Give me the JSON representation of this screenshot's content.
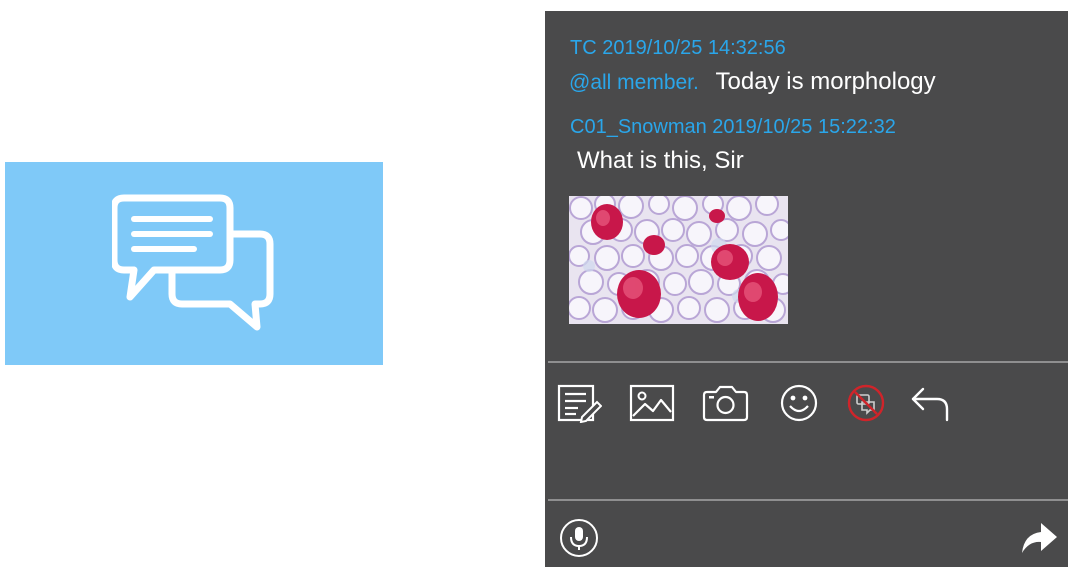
{
  "chat": {
    "messages": [
      {
        "header": "TC 2019/10/25 14:32:56",
        "mention": "@all member.",
        "text": "Today is morphology"
      },
      {
        "header": "C01_Snowman 2019/10/25 15:22:32",
        "text": "What is this, Sir",
        "has_image": true
      }
    ]
  },
  "toolbar": {
    "icons": [
      "note-edit-icon",
      "image-icon",
      "camera-icon",
      "emoji-icon",
      "no-chat-icon",
      "reply-icon"
    ]
  },
  "input_bar": {
    "icons": [
      "microphone-icon",
      "send-icon"
    ]
  },
  "colors": {
    "tile_blue": "#7fc9f8",
    "panel_bg": "#4a4a4b",
    "header_blue": "#2aa6ea",
    "alert_red": "#d0242a"
  }
}
